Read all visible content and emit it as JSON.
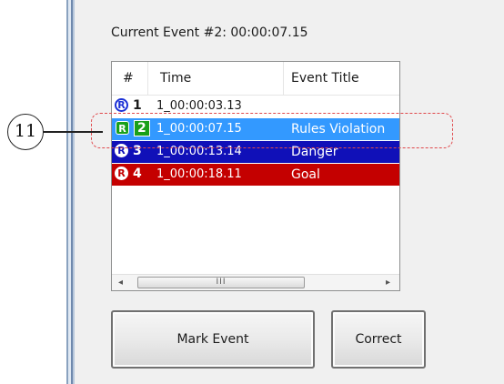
{
  "current_event_label": "Current Event #2: 00:00:07.15",
  "table": {
    "headers": [
      "#",
      "Time",
      "Event Title"
    ],
    "rows": [
      {
        "badge": "R",
        "num": "1",
        "time": "1_00:00:03.13",
        "title": ""
      },
      {
        "badge": "R",
        "num": "2",
        "time": "1_00:00:07.15",
        "title": "Rules Violation"
      },
      {
        "badge": "R",
        "num": "3",
        "time": "1_00:00:13.14",
        "title": "Danger"
      },
      {
        "badge": "R",
        "num": "4",
        "time": "1_00:00:18.11",
        "title": "Goal"
      }
    ],
    "row_colors": [
      "#ffffff",
      "#3399ff",
      "#1010b8",
      "#c40000"
    ]
  },
  "scrollbar": {
    "left_arrow": "◂",
    "right_arrow": "▸",
    "thumb_grip": "III"
  },
  "buttons": {
    "mark_event": "Mark Event",
    "correct": "Correct"
  },
  "callout": {
    "number": "11",
    "highlight_color": "#e0494c"
  }
}
